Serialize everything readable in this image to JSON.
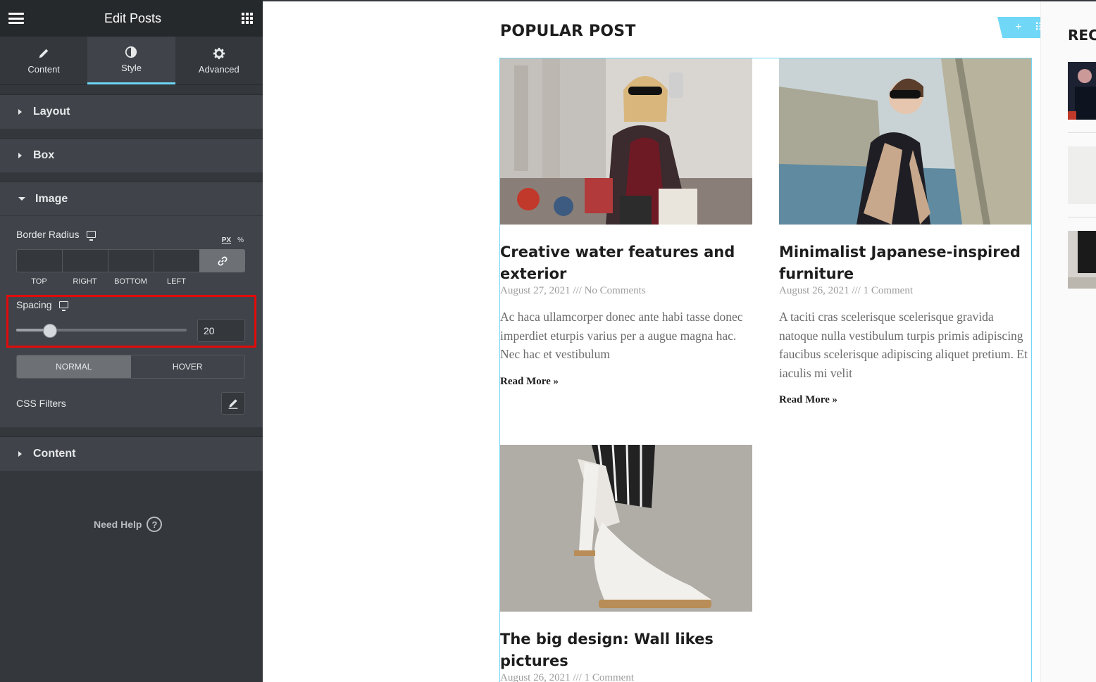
{
  "panel": {
    "title": "Edit Posts",
    "tabs": [
      {
        "label": "Content",
        "icon": "pencil-icon"
      },
      {
        "label": "Style",
        "icon": "contrast-icon",
        "active": true
      },
      {
        "label": "Advanced",
        "icon": "gear-icon"
      }
    ],
    "sections": {
      "layout": "Layout",
      "box": "Box",
      "image": "Image",
      "content": "Content"
    },
    "border_radius": {
      "label": "Border Radius",
      "unit_px": "PX",
      "unit_pct": "%",
      "labels": [
        "TOP",
        "RIGHT",
        "BOTTOM",
        "LEFT"
      ]
    },
    "spacing": {
      "label": "Spacing",
      "value": "20",
      "slider_fraction": 0.2
    },
    "state_toggle": {
      "normal": "NORMAL",
      "hover": "HOVER"
    },
    "css_filters": "CSS Filters",
    "need_help": "Need Help",
    "help_icon": "?"
  },
  "preview": {
    "heading": "POPULAR POST",
    "handle": {
      "add": "+",
      "move": "⠿",
      "close": "✕"
    },
    "posts": [
      {
        "title": "Creative water features and exterior",
        "meta": "August 27, 2021 /// No Comments",
        "excerpt": "Ac haca ullamcorper donec ante habi tasse donec imperdiet eturpis varius per a augue magna hac. Nec hac et vestibulum",
        "read_more": "Read More »"
      },
      {
        "title": "Minimalist Japanese-inspired furniture",
        "meta": "August 26, 2021 /// 1 Comment",
        "excerpt": "A taciti cras scelerisque scelerisque gravida natoque nulla vestibulum turpis primis adipiscing faucibus scelerisque adipiscing aliquet pretium. Et iaculis mi velit",
        "read_more": "Read More »"
      },
      {
        "title": "The big design: Wall likes pictures",
        "meta": "August 26, 2021 /// 1 Comment"
      }
    ],
    "recent_title": "REC"
  },
  "colors": {
    "panel_bg": "#404349",
    "accent": "#71d7f7",
    "highlight": "#e10b0b"
  }
}
